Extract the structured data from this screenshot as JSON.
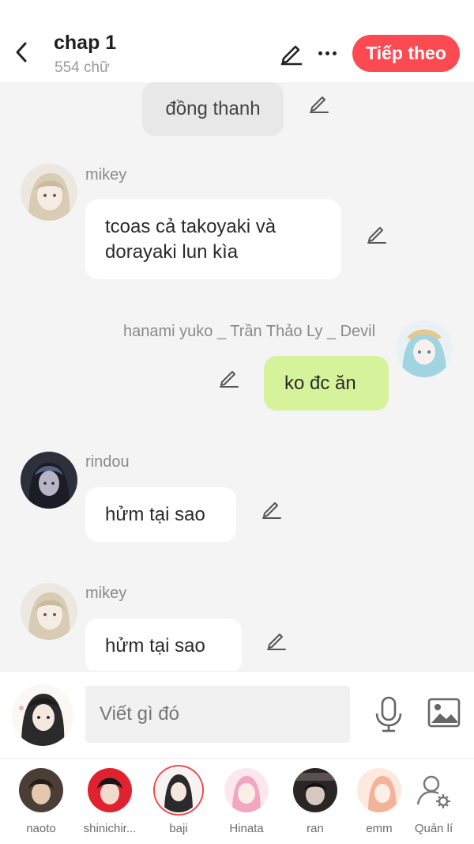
{
  "header": {
    "title": "chap 1",
    "subtitle": "554 chữ",
    "next_label": "Tiếp theo"
  },
  "messages": [
    {
      "type": "narration",
      "text": "đồng thanh"
    },
    {
      "type": "left",
      "name": "mikey",
      "text": "tcoas cả takoyaki và dorayaki lun kìa"
    },
    {
      "type": "right",
      "name": "hanami yuko _ Trần Thảo Ly _ Devil",
      "text": "ko đc ăn"
    },
    {
      "type": "left",
      "name": "rindou",
      "text": "hửm tại sao"
    },
    {
      "type": "left",
      "name": "mikey",
      "text": "hửm tại sao"
    }
  ],
  "input": {
    "placeholder": "Viết gì đó"
  },
  "characters": [
    {
      "label": "naoto"
    },
    {
      "label": "shinichir..."
    },
    {
      "label": "baji"
    },
    {
      "label": "Hinata"
    },
    {
      "label": "ran"
    },
    {
      "label": "emm"
    },
    {
      "label": "Quản lí"
    }
  ],
  "colors": {
    "accent": "#fb4a52",
    "right_bubble": "#d6f39c",
    "background": "#f4f4f4"
  }
}
